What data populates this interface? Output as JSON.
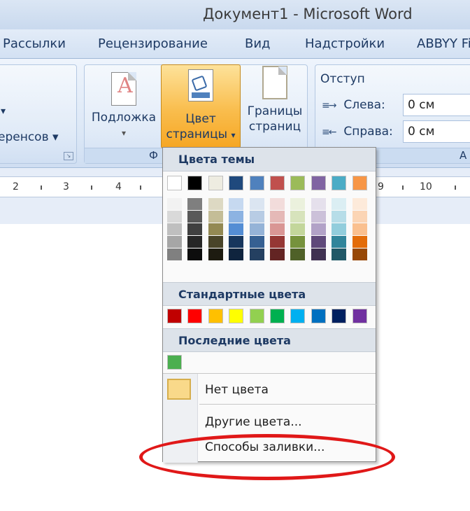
{
  "window": {
    "title": "Документ1 - Microsoft Word"
  },
  "tabs": [
    "Рассылки",
    "Рецензирование",
    "Вид",
    "Надстройки",
    "ABBYY Fi"
  ],
  "ribbon": {
    "hyphenation_label": "еренсов",
    "hyphenation_arrow": "▾",
    "watermark_label": "Подложка",
    "watermark_arrow": "▾",
    "page_color_line1": "Цвет",
    "page_color_line2": "страницы",
    "page_color_arrow": "▾",
    "borders_line1": "Границы",
    "borders_line2": "страниц",
    "group_label_partial": "Ф",
    "group_label_partial_right": "А",
    "indent": {
      "title": "Отступ",
      "left_label": "Слева:",
      "left_value": "0 см",
      "right_label": "Справа:",
      "right_value": "0 см"
    }
  },
  "ruler": {
    "numbers": [
      "2",
      "3",
      "4",
      "9",
      "10"
    ]
  },
  "page_color_menu": {
    "theme_colors_header": "Цвета темы",
    "theme_colors": [
      "#ffffff",
      "#000000",
      "#eeece1",
      "#1f497d",
      "#4f81bd",
      "#c0504d",
      "#9bbb59",
      "#8064a2",
      "#4bacc6",
      "#f79646"
    ],
    "theme_shades": [
      [
        "#f2f2f2",
        "#d9d9d9",
        "#bfbfbf",
        "#a6a6a6",
        "#808080"
      ],
      [
        "#7f7f7f",
        "#595959",
        "#404040",
        "#262626",
        "#0d0d0d"
      ],
      [
        "#ddd9c3",
        "#c4bd97",
        "#938953",
        "#494429",
        "#1d1b10"
      ],
      [
        "#c6d9f0",
        "#8db3e2",
        "#548dd4",
        "#17365d",
        "#0f243e"
      ],
      [
        "#dbe5f1",
        "#b8cce4",
        "#95b3d7",
        "#366092",
        "#244061"
      ],
      [
        "#f2dcdb",
        "#e5b9b7",
        "#d99694",
        "#953734",
        "#632423"
      ],
      [
        "#ebf1dd",
        "#d7e3bc",
        "#c3d69b",
        "#76923c",
        "#4f6128"
      ],
      [
        "#e5e0ec",
        "#ccc1d9",
        "#b2a2c7",
        "#5f497a",
        "#3f3151"
      ],
      [
        "#dbeef3",
        "#b7dde8",
        "#92cddc",
        "#31859b",
        "#205867"
      ],
      [
        "#fdeada",
        "#fbd5b5",
        "#fac08f",
        "#e36c09",
        "#974806"
      ]
    ],
    "standard_colors_header": "Стандартные цвета",
    "standard_colors": [
      "#c00000",
      "#ff0000",
      "#ffc000",
      "#ffff00",
      "#92d050",
      "#00b050",
      "#00b0f0",
      "#0070c0",
      "#002060",
      "#7030a0"
    ],
    "recent_colors_header": "Последние цвета",
    "recent_colors": [
      "#4caf50"
    ],
    "no_color_label": "Нет цвета",
    "more_colors_label": "Другие цвета...",
    "fill_effects_label": "Способы заливки..."
  }
}
